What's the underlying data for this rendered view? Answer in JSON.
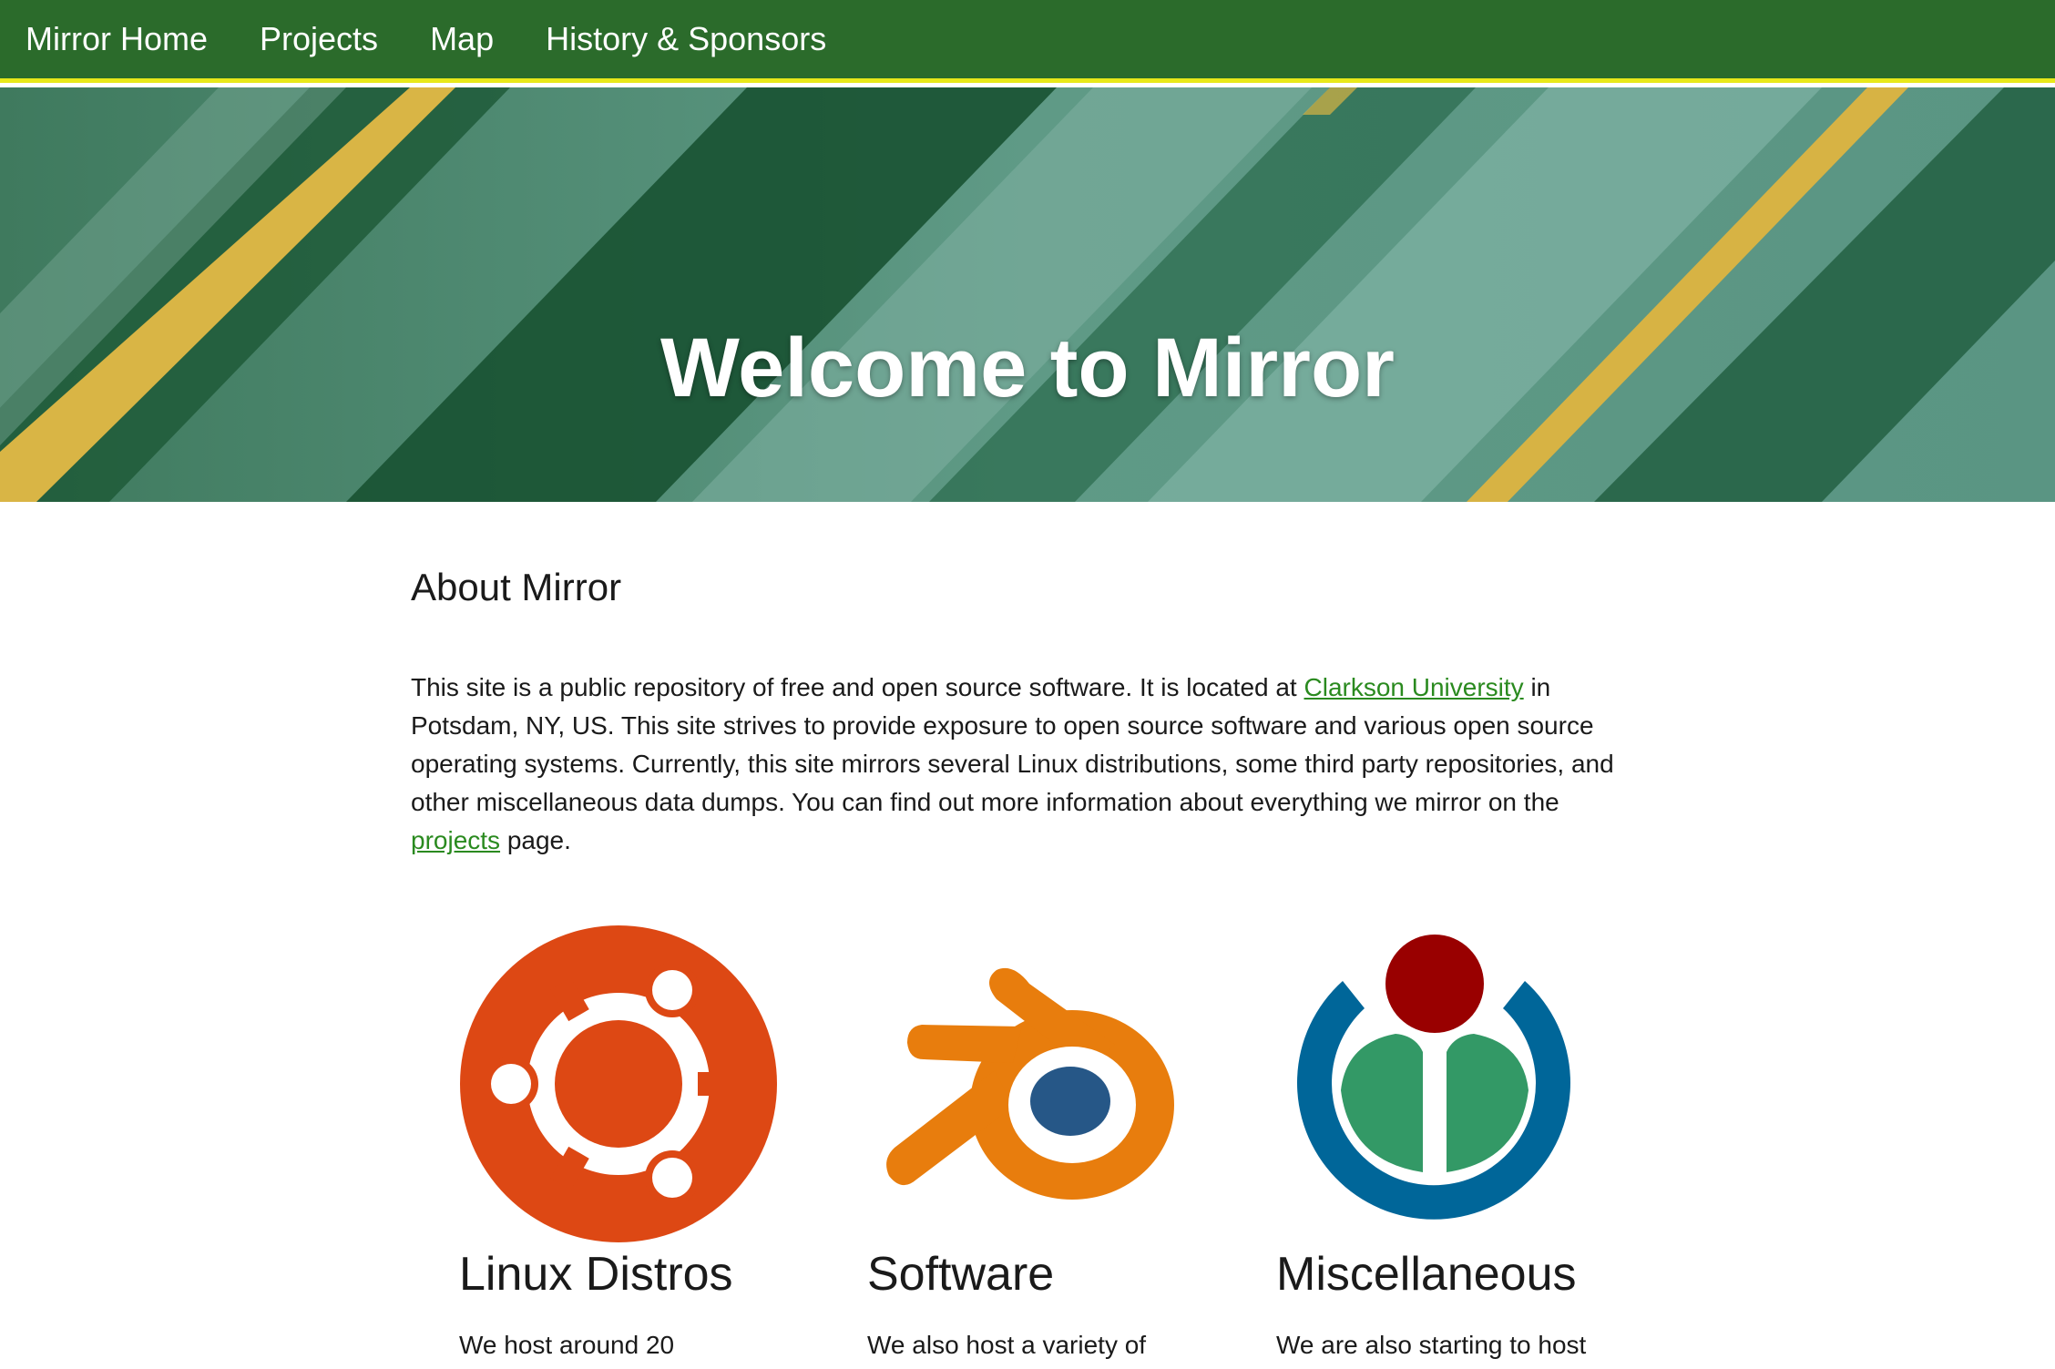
{
  "nav": {
    "items": [
      {
        "label": "Mirror Home"
      },
      {
        "label": "Projects"
      },
      {
        "label": "Map"
      },
      {
        "label": "History & Sponsors"
      }
    ]
  },
  "hero": {
    "title": "Welcome to Mirror"
  },
  "about": {
    "heading": "About Mirror",
    "text_1": "This site is a public repository of free and open source software. It is located at ",
    "link_clarkson": "Clarkson University",
    "text_2": " in Potsdam, NY, US. This site strives to provide exposure to open source software and various open source operating systems. Currently, this site mirrors several Linux distributions, some third party repositories, and other miscellaneous data dumps. You can find out more information about everything we mirror on the ",
    "link_projects": "projects",
    "text_3": " page."
  },
  "cards": [
    {
      "title": "Linux Distros",
      "text": "We host around 20",
      "logo": "ubuntu-logo-icon"
    },
    {
      "title": "Software",
      "text": "We also host a variety of",
      "logo": "blender-logo-icon"
    },
    {
      "title": "Miscellaneous",
      "text": "We are also starting to host",
      "logo": "wikimedia-logo-icon"
    }
  ],
  "colors": {
    "nav_bg": "#2b6b2b",
    "nav_border": "#e8e81a",
    "link": "#2a8a1f",
    "ubuntu": "#dd4814",
    "blender_orange": "#e87d0d",
    "blender_blue": "#265787",
    "wikimedia_blue": "#006699",
    "wikimedia_green": "#339966",
    "wikimedia_red": "#990000"
  }
}
